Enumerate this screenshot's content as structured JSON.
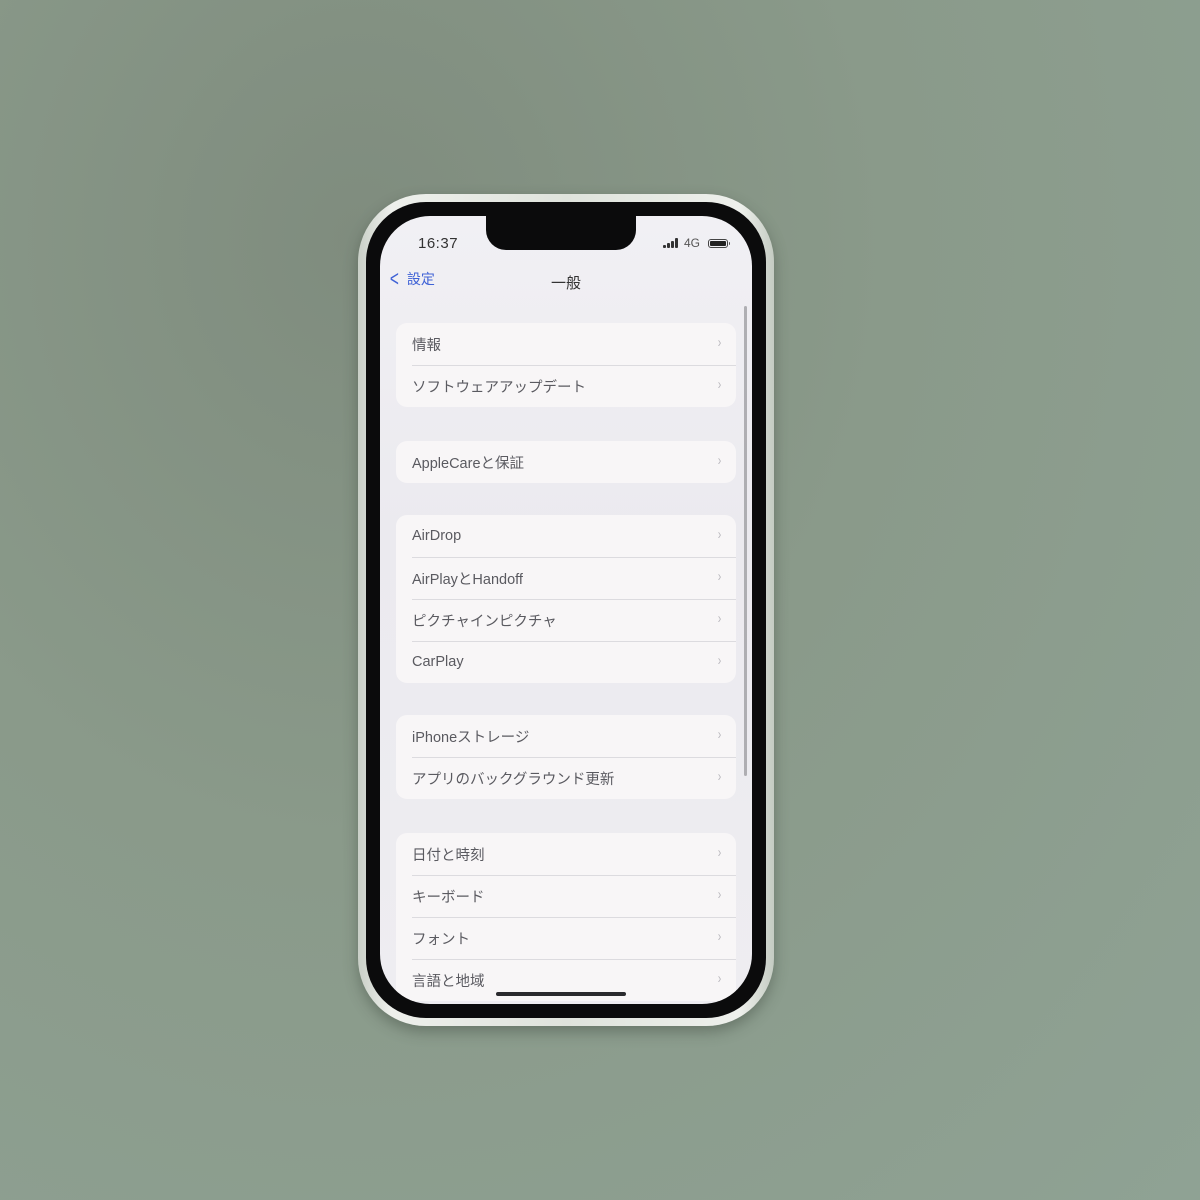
{
  "status_bar": {
    "time": "16:37",
    "network": "4G",
    "signal_bars": 4,
    "battery_level": 1.0
  },
  "nav": {
    "back_label": "設定",
    "title": "一般",
    "accent_color": "#3f62d6"
  },
  "groups": [
    {
      "items": [
        {
          "label": "情報"
        },
        {
          "label": "ソフトウェアアップデート"
        }
      ]
    },
    {
      "items": [
        {
          "label": "AppleCareと保証"
        }
      ]
    },
    {
      "items": [
        {
          "label": "AirDrop"
        },
        {
          "label": "AirPlayとHandoff"
        },
        {
          "label": "ピクチャインピクチャ"
        },
        {
          "label": "CarPlay"
        }
      ]
    },
    {
      "items": [
        {
          "label": "iPhoneストレージ"
        },
        {
          "label": "アプリのバックグラウンド更新"
        }
      ]
    },
    {
      "items": [
        {
          "label": "日付と時刻"
        },
        {
          "label": "キーボード"
        },
        {
          "label": "フォント"
        },
        {
          "label": "言語と地域"
        }
      ]
    }
  ],
  "chevron_glyph": "›"
}
